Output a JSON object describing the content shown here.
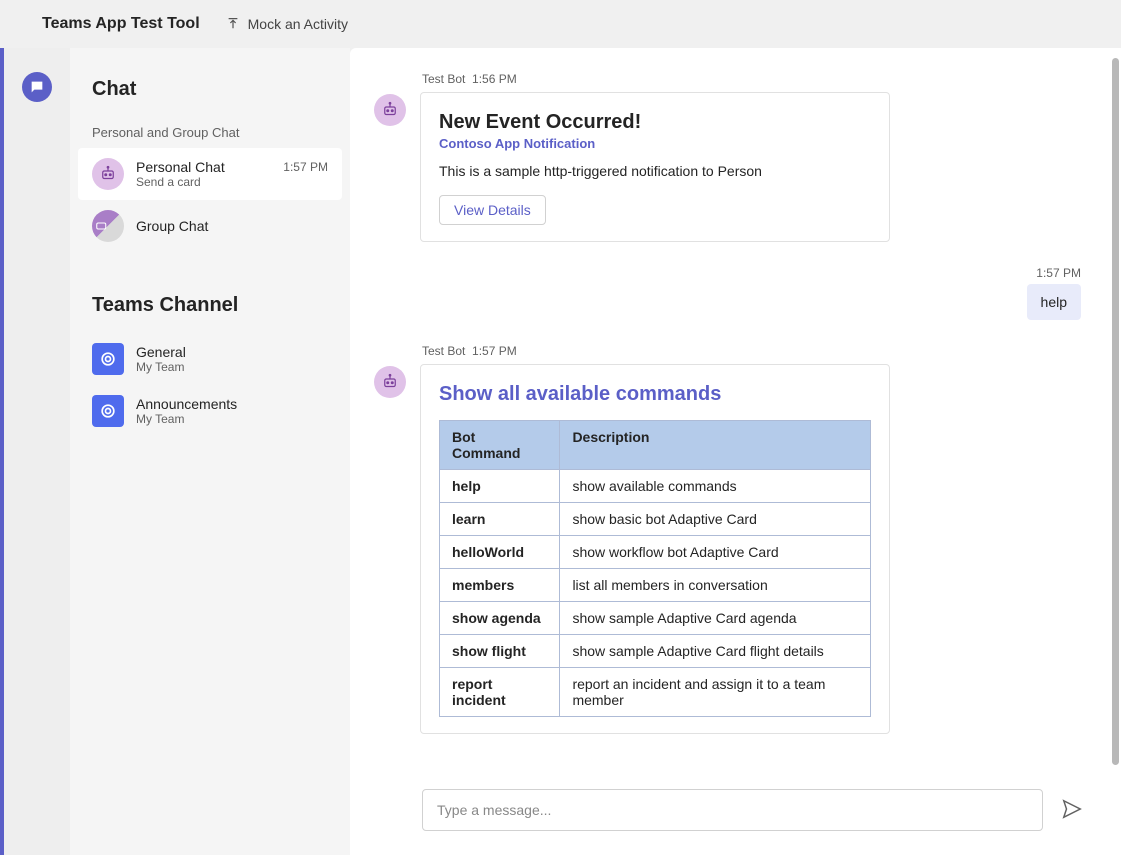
{
  "topbar": {
    "title": "Teams App Test Tool",
    "mock_action_label": "Mock an Activity"
  },
  "sidebar": {
    "chat_section_title": "Chat",
    "chat_subheader": "Personal and Group Chat",
    "channel_section_title": "Teams Channel",
    "chat_items": [
      {
        "name": "Personal Chat",
        "sub": "Send a card",
        "time": "1:57 PM",
        "active": true,
        "avatar": "bot"
      },
      {
        "name": "Group Chat",
        "sub": "",
        "time": "",
        "active": false,
        "avatar": "group"
      }
    ],
    "channel_items": [
      {
        "name": "General",
        "sub": "My Team"
      },
      {
        "name": "Announcements",
        "sub": "My Team"
      }
    ]
  },
  "messages": {
    "bot_name": "Test Bot",
    "msg1": {
      "time": "1:56 PM",
      "card_title": "New Event Occurred!",
      "card_subtitle": "Contoso App Notification",
      "card_body": "This is a sample http-triggered notification to Person",
      "card_button": "View Details"
    },
    "user1": {
      "time": "1:57 PM",
      "text": "help"
    },
    "msg2": {
      "time": "1:57 PM",
      "card_title": "Show all available commands",
      "table_headers": {
        "col1": "Bot Command",
        "col2": "Description"
      },
      "rows": [
        {
          "cmd": "help",
          "desc": "show available commands"
        },
        {
          "cmd": "learn",
          "desc": "show basic bot Adaptive Card"
        },
        {
          "cmd": "helloWorld",
          "desc": "show workflow bot Adaptive Card"
        },
        {
          "cmd": "members",
          "desc": "list all members in conversation"
        },
        {
          "cmd": "show agenda",
          "desc": "show sample Adaptive Card agenda"
        },
        {
          "cmd": "show flight",
          "desc": "show sample Adaptive Card flight details"
        },
        {
          "cmd": "report incident",
          "desc": "report an incident and assign it to a team member"
        }
      ]
    }
  },
  "composer": {
    "placeholder": "Type a message..."
  }
}
